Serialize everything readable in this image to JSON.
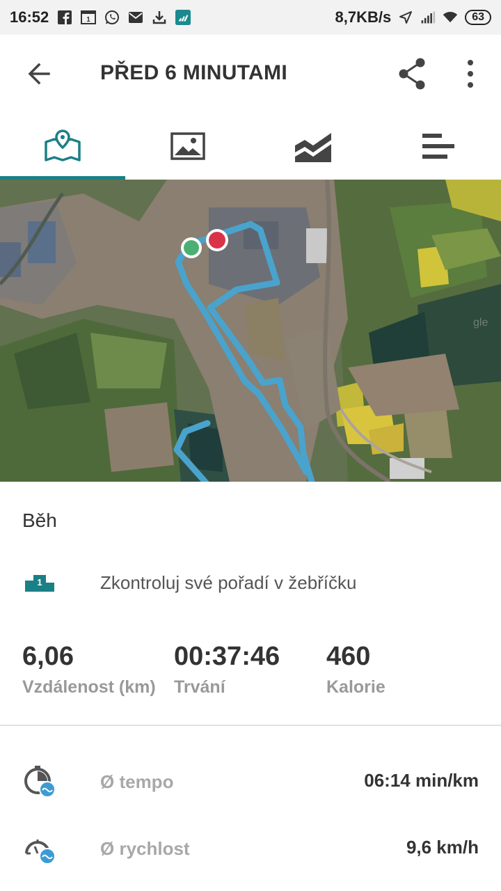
{
  "status_bar": {
    "time": "16:52",
    "network_speed": "8,7KB/s",
    "battery": "63",
    "notification_icons": [
      "facebook-icon",
      "calendar-icon",
      "whatsapp-icon",
      "mail-icon",
      "download-icon",
      "adidas-icon"
    ],
    "calendar_day": "1"
  },
  "header": {
    "title": "PŘED 6 MINUTAMI"
  },
  "tabs": [
    {
      "icon": "map-tab-icon",
      "active": true
    },
    {
      "icon": "photo-tab-icon",
      "active": false
    },
    {
      "icon": "chart-tab-icon",
      "active": false
    },
    {
      "icon": "splits-tab-icon",
      "active": false
    }
  ],
  "map": {
    "route_color": "#4aa3cc",
    "start_marker_color": "#4caf73",
    "end_marker_color": "#d9334a"
  },
  "activity_type": "Běh",
  "leaderboard": {
    "text": "Zkontroluj své pořadí v žebříčku",
    "badge_number": "1"
  },
  "stats": [
    {
      "value": "6,06",
      "label": "Vzdálenost (km)"
    },
    {
      "value": "00:37:46",
      "label": "Trvání"
    },
    {
      "value": "460",
      "label": "Kalorie"
    }
  ],
  "details": [
    {
      "label": "Ø tempo",
      "value": "06:14 min/km",
      "icon": "pace-icon"
    },
    {
      "label": "Ø rychlost",
      "value": "9,6 km/h",
      "icon": "speed-icon"
    }
  ],
  "colors": {
    "accent": "#1b7f86",
    "text": "#333333",
    "muted": "#999999"
  }
}
